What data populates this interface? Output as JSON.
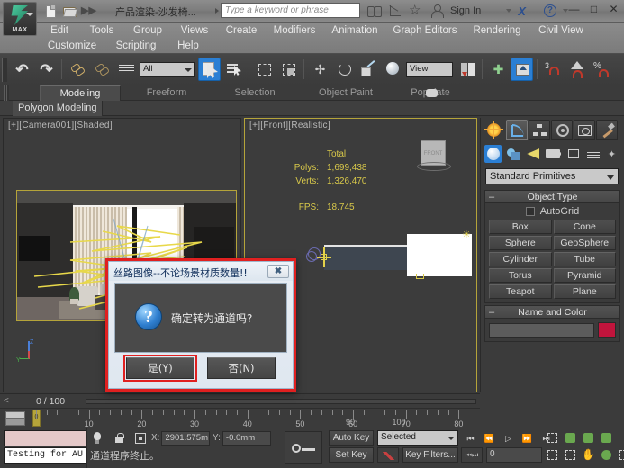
{
  "titlebar": {
    "document_title": "产品渲染-沙发椅...",
    "search_placeholder": "Type a keyword or phrase",
    "sign_in": "Sign In",
    "icons": [
      "new-file-icon",
      "open-file-icon",
      "more-commands-icon",
      "binoculars-icon",
      "curve-editor-icon",
      "star-icon",
      "person-icon",
      "autodesk-x-icon",
      "help-icon"
    ],
    "window_buttons": {
      "minimize": "—",
      "maximize": "□",
      "close": "✕"
    },
    "logo_label": "MAX"
  },
  "menubar": {
    "row1": [
      "Edit",
      "Tools",
      "Group",
      "Views",
      "Create",
      "Modifiers",
      "Animation",
      "Graph Editors",
      "Rendering",
      "Civil View"
    ],
    "row2": [
      "Customize",
      "Scripting",
      "Help"
    ]
  },
  "toolbar": {
    "selection_filter": "All",
    "reference_coord": "View",
    "snap_count": "3",
    "percent": "%",
    "icons": [
      "undo-icon",
      "redo-icon",
      "select-link-icon",
      "unlink-icon",
      "bind-spacewarp-icon",
      "select-object-icon",
      "select-by-name-icon",
      "rect-select-icon",
      "window-crossing-icon",
      "select-move-icon",
      "select-rotate-icon",
      "select-scale-icon",
      "mirror-icon",
      "align-icon",
      "snap-toggle-icon",
      "angle-snap-icon",
      "percent-snap-icon",
      "layer-manager-icon",
      "pivot-icon"
    ]
  },
  "ribbon": {
    "tabs": [
      "Modeling",
      "Freeform",
      "Selection",
      "Object Paint",
      "Populate"
    ],
    "active_tab": "Modeling",
    "subtab": "Polygon Modeling"
  },
  "viewports": {
    "left": {
      "label": "[+][Camera001][Shaded]"
    },
    "right": {
      "label": "[+][Front][Realistic]",
      "stats": {
        "header": "Total",
        "polys_label": "Polys:",
        "polys_value": "1,699,438",
        "verts_label": "Verts:",
        "verts_value": "1,326,470",
        "fps_label": "FPS:",
        "fps_value": "18.745"
      },
      "viewcube_label": "FRONT"
    }
  },
  "command_panel": {
    "tabs": [
      "create-tab",
      "modify-tab",
      "hierarchy-tab",
      "motion-tab",
      "display-tab",
      "utilities-tab"
    ],
    "category_icons": [
      "geometry-icon",
      "shapes-icon",
      "lights-icon",
      "cameras-icon",
      "helpers-icon",
      "space-warps-icon",
      "systems-icon"
    ],
    "subcategory": "Standard Primitives",
    "object_type": {
      "header": "Object Type",
      "autogrid": "AutoGrid",
      "buttons": [
        "Box",
        "Cone",
        "Sphere",
        "GeoSphere",
        "Cylinder",
        "Tube",
        "Torus",
        "Pyramid",
        "Teapot",
        "Plane"
      ]
    },
    "name_and_color": {
      "header": "Name and Color",
      "name_value": "",
      "color": "#c0143c"
    }
  },
  "dialog": {
    "title": "丝路图像--不论场景材质数量!!",
    "close_label": "✖",
    "message": "确定转为通道吗?",
    "icon": "question-icon",
    "buttons": [
      {
        "label": "是(Y)",
        "highlighted": true
      },
      {
        "label": "否(N)",
        "highlighted": false
      }
    ],
    "highlight_color": "#e02020"
  },
  "timebar": {
    "prev_arrow": "<",
    "frame_indicator": "0 / 100",
    "slider_value": "0",
    "ruler_ticks": [
      "10",
      "20",
      "30",
      "40",
      "50",
      "60",
      "70",
      "80",
      "90",
      "100"
    ]
  },
  "statusbar": {
    "maxscript_listener_value": "Testing for AU",
    "icons": [
      "bulb-icon",
      "lock-icon",
      "selection-lock-icon"
    ],
    "coords": {
      "x_label": "X:",
      "x_value": "2901.575m",
      "y_label": "Y:",
      "y_value": "-0.0mm"
    },
    "prompt": "通道程序终止。",
    "key_mode_icon": "key-icon",
    "auto_key": "Auto Key",
    "set_key": "Set Key",
    "key_mode_dropdown": "Selected",
    "key_filters": "Key Filters...",
    "curve_editor_icon": "curve-editor-icon",
    "current_frame": "0",
    "playback_icons": [
      "go-to-start-icon",
      "previous-frame-icon",
      "play-icon",
      "next-frame-icon",
      "go-to-end-icon",
      "key-mode-toggle-icon"
    ],
    "nav_icons_row1": [
      "zoom-icon",
      "zoom-all-icon",
      "zoom-extents-icon",
      "zoom-region-icon"
    ],
    "nav_icons_row2": [
      "maximize-viewport-icon",
      "selected-region-icon",
      "pan-icon",
      "orbit-icon",
      "maximize-toggle-icon"
    ]
  }
}
